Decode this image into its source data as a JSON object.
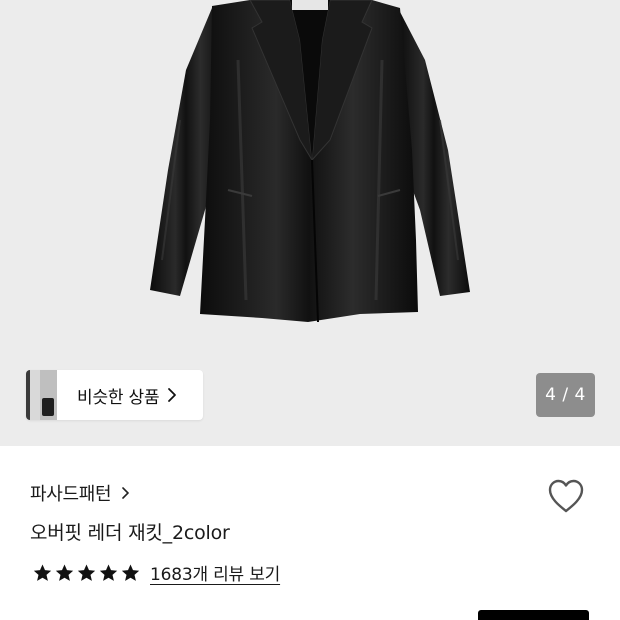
{
  "gallery": {
    "similar_label": "비슷한 상품",
    "counter": "4 / 4"
  },
  "product": {
    "brand": "파사드패턴",
    "name": "오버핏 레더 재킷_2color",
    "rating_stars": 5,
    "review_link": "1683개 리뷰 보기"
  },
  "colors": {
    "background_hero": "#ececec",
    "jacket": "#141414",
    "counter_bg": "#6e6e6e",
    "cta": "#000000"
  },
  "icons": {
    "similar_chevron": "chevron-right-icon",
    "brand_chevron": "chevron-right-icon",
    "wishlist": "heart-outline-icon",
    "star": "star-filled-icon"
  }
}
